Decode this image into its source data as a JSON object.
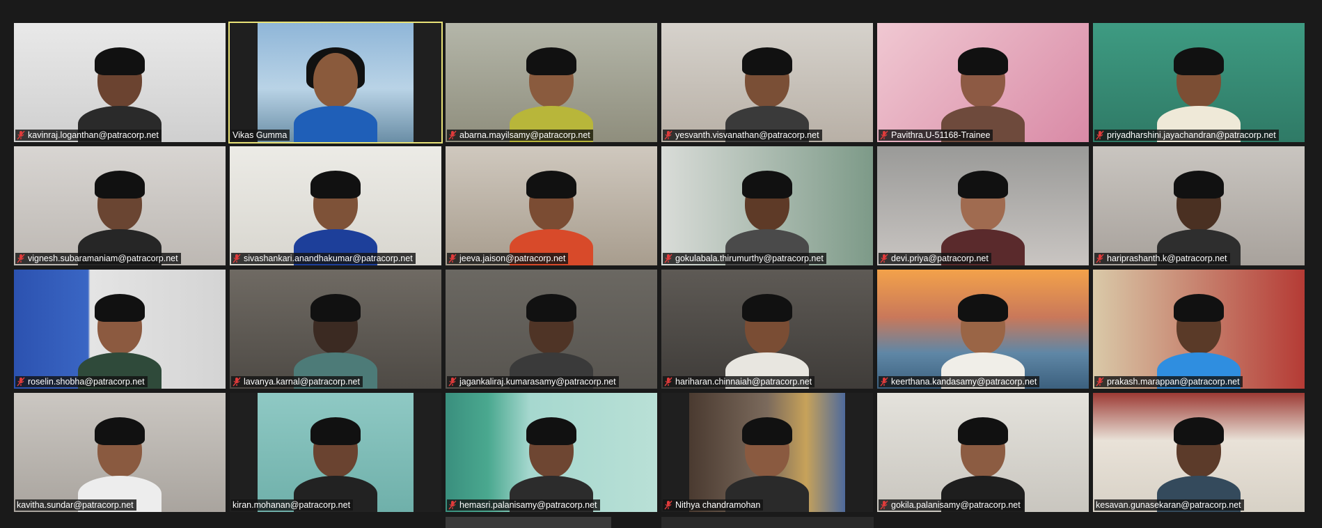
{
  "colors": {
    "background": "#1a1a1a",
    "active_speaker_border": "#e9e277",
    "muted_icon": "#e03b3b",
    "name_text": "#ffffff"
  },
  "participants": [
    {
      "name": "kavinraj.loganthan@patracorp.net",
      "muted": true
    },
    {
      "name": "Vikas Gumma",
      "muted": false
    },
    {
      "name": "abarna.mayilsamy@patracorp.net",
      "muted": true
    },
    {
      "name": "yesvanth.visvanathan@patracorp.net",
      "muted": true
    },
    {
      "name": "Pavithra.U-51168-Trainee",
      "muted": true
    },
    {
      "name": "priyadharshini.jayachandran@patracorp.net",
      "muted": true
    },
    {
      "name": "vignesh.subaramaniam@patracorp.net",
      "muted": true
    },
    {
      "name": "sivashankari.anandhakumar@patracorp.net",
      "muted": true
    },
    {
      "name": "jeeva.jaison@patracorp.net",
      "muted": true
    },
    {
      "name": "gokulabala.thirumurthy@patracorp.net",
      "muted": true
    },
    {
      "name": "devi.priya@patracorp.net",
      "muted": true
    },
    {
      "name": "hariprashanth.k@patracorp.net",
      "muted": true
    },
    {
      "name": "roselin.shobha@patracorp.net",
      "muted": true
    },
    {
      "name": "lavanya.karnal@patracorp.net",
      "muted": true
    },
    {
      "name": "jagankaliraj.kumarasamy@patracorp.net",
      "muted": true
    },
    {
      "name": "hariharan.chinnaiah@patracorp.net",
      "muted": true
    },
    {
      "name": "keerthana.kandasamy@patracorp.net",
      "muted": true
    },
    {
      "name": "prakash.marappan@patracorp.net",
      "muted": true
    },
    {
      "name": "kavitha.sundar@patracorp.net",
      "muted": false
    },
    {
      "name": "kiran.mohanan@patracorp.net",
      "muted": false
    },
    {
      "name": "hemasri.palanisamy@patracorp.net",
      "muted": true
    },
    {
      "name": "Nithya chandramohan",
      "muted": true
    },
    {
      "name": "gokila.palanisamy@patracorp.net",
      "muted": true
    },
    {
      "name": "kesavan.gunasekaran@patracorp.net",
      "muted": false
    }
  ]
}
